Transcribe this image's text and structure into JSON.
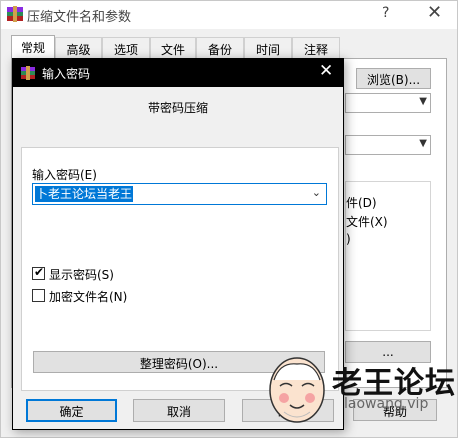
{
  "parent_window": {
    "title": "压缩文件名和参数",
    "help_glyph": "?",
    "close_glyph": "✕",
    "tabs": [
      "常规",
      "高级",
      "选项",
      "文件",
      "备份",
      "时间",
      "注释"
    ],
    "browse_label": "浏览(B)...",
    "option_partial_1": "件(D)",
    "option_partial_2": "文件(X)",
    "option_partial_3": ")",
    "dots_label": "...",
    "help_button": "帮助"
  },
  "dialog": {
    "title": "输入密码",
    "close_glyph": "✕",
    "heading": "带密码压缩",
    "password_label": "输入密码(E)",
    "password_value": "卜老王论坛当老王",
    "checkboxes": [
      {
        "label": "显示密码(S)",
        "checked": true
      },
      {
        "label": "加密文件名(N)",
        "checked": false
      }
    ],
    "manage_button": "整理密码(O)...",
    "ok_button": "确定",
    "cancel_button": "取消",
    "help_button_partial": "帮"
  },
  "watermark": {
    "title": "老王论坛",
    "url": "laowang.vip"
  },
  "colors": {
    "accent": "#0078d7",
    "dialog_titlebar": "#000000"
  }
}
